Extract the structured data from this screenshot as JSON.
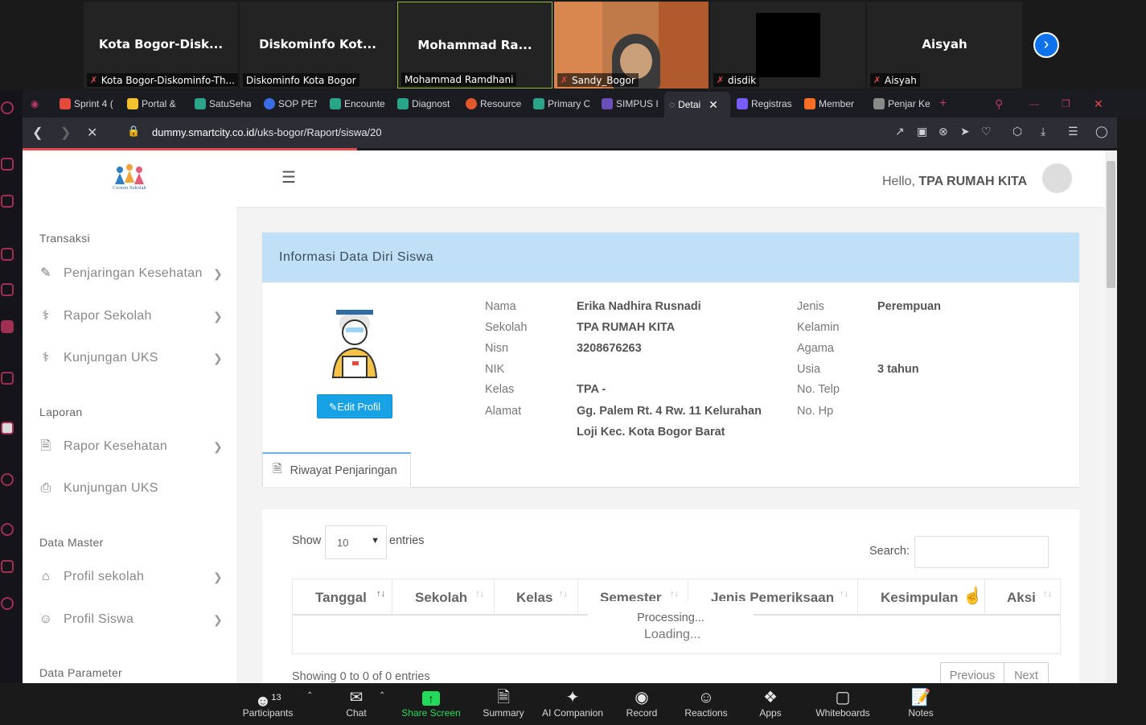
{
  "participants": [
    {
      "name": "Kota  Bogor-Disk...",
      "label": "Kota Bogor-Diskominfo-Th...",
      "muted": true
    },
    {
      "name": "Diskominfo  Kot...",
      "label": "Diskominfo Kota Bogor",
      "muted": false
    },
    {
      "name": "Mohammad  Ra...",
      "label": "Mohammad Ramdhani",
      "muted": false
    },
    {
      "name": "",
      "label": "Sandy_Bogor",
      "muted": true
    },
    {
      "name": "",
      "label": "disdik",
      "muted": true
    },
    {
      "name": "Aisyah",
      "label": "Aisyah",
      "muted": true
    }
  ],
  "browser": {
    "tabs": [
      "Sprint 4 (",
      "Portal &",
      "SatuSeha",
      "SOP PEN",
      "Encounte",
      "Diagnost",
      "Resource",
      "Primary C",
      "SIMPUS I",
      "Detai",
      "Registras",
      "Member",
      "Penjar Ke"
    ],
    "url_host": "dummy.smartcity.co.id",
    "url_path": "/uks-bogor/Raport/siswa/20"
  },
  "header": {
    "greeting": "Hello, ",
    "user": "TPA RUMAH KITA",
    "logo_text": "Cermin Sekolah"
  },
  "sidebar": {
    "sections": [
      "Transaksi",
      "Laporan",
      "Data Master",
      "Data Parameter"
    ],
    "items": [
      {
        "label": "Penjaringan Kesehatan",
        "icon": "pencil-icon",
        "chevron": true
      },
      {
        "label": "Rapor Sekolah",
        "icon": "stethoscope-icon",
        "chevron": true
      },
      {
        "label": "Kunjungan UKS",
        "icon": "stethoscope-icon",
        "chevron": true
      },
      {
        "label": "Rapor Kesehatan",
        "icon": "document-icon",
        "chevron": true
      },
      {
        "label": "Kunjungan UKS",
        "icon": "printer-icon",
        "chevron": false
      },
      {
        "label": "Profil sekolah",
        "icon": "home-icon",
        "chevron": true
      },
      {
        "label": "Profil Siswa",
        "icon": "user-icon",
        "chevron": true
      }
    ]
  },
  "student": {
    "card_title": "Informasi Data Diri Siswa",
    "edit_label": "Edit Profil",
    "labels": {
      "nama": "Nama",
      "sekolah": "Sekolah",
      "nisn": "Nisn",
      "nik": "NIK",
      "kelas": "Kelas",
      "alamat": "Alamat",
      "jenis": "Jenis",
      "kelamin": "Kelamin",
      "agama": "Agama",
      "usia": "Usia",
      "telp": "No. Telp",
      "hp": "No. Hp"
    },
    "nama": "Erika Nadhira Rusnadi",
    "sekolah": "TPA RUMAH KITA",
    "nisn": "3208676263",
    "nik": "",
    "kelas": "TPA -",
    "alamat_1": "Gg. Palem Rt. 4 Rw. 11 Kelurahan",
    "alamat_2": "Loji Kec. Kota Bogor Barat",
    "jenis_kelamin": "Perempuan",
    "agama": "",
    "usia": "3 tahun",
    "tab_label": "Riwayat Penjaringan"
  },
  "table": {
    "show_label": "Show",
    "entries_label": "entries",
    "page_size": "10",
    "search_label": "Search:",
    "columns": [
      "Tanggal",
      "Sekolah",
      "Kelas",
      "Semester",
      "Jenis Pemeriksaan",
      "Kesimpulan",
      "Aksi"
    ],
    "processing": "Processing...",
    "loading": "Loading...",
    "info": "Showing 0 to 0 of 0 entries",
    "prev": "Previous",
    "next": "Next"
  },
  "zoom_toolbar": {
    "participants_count": "13",
    "items": [
      "Participants",
      "Chat",
      "Share Screen",
      "Summary",
      "AI Companion",
      "Record",
      "Reactions",
      "Apps",
      "Whiteboards",
      "Notes"
    ]
  },
  "colors": {
    "accent": "#17a2e6",
    "card_header": "#bfe0f6",
    "share_green": "#23d959",
    "zoom_blue": "#0e72ed"
  }
}
